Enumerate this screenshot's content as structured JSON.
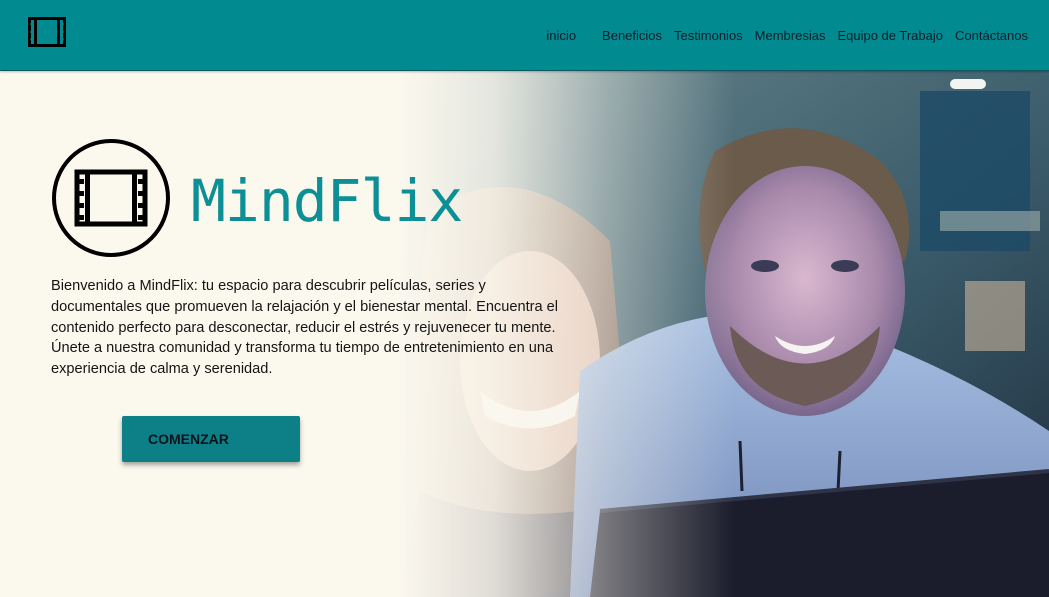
{
  "nav": {
    "logo_icon": "film-strip-icon",
    "items": [
      "inicio",
      "Beneficios",
      "Testimonios",
      "Membresias",
      "Equipo de Trabajo",
      "Contáctanos"
    ]
  },
  "hero": {
    "logo_icon": "film-strip-circle-icon",
    "title": "MindFlix",
    "intro": "Bienvenido a MindFlix: tu espacio para descubrir películas, series y documentales que promueven la relajación y el bienestar mental. Encuentra el contenido perfecto para desconectar, reducir el estrés y rejuvenecer tu mente. Únete a nuestra comunidad y transforma tu tiempo de entretenimiento en una experiencia de calma y serenidad.",
    "cta_label": "COMENZAR"
  },
  "colors": {
    "navbar_bg": "#028a91",
    "title_color": "#0d8f96",
    "button_bg": "#0d7f87",
    "page_bg": "#fbf8ee"
  }
}
